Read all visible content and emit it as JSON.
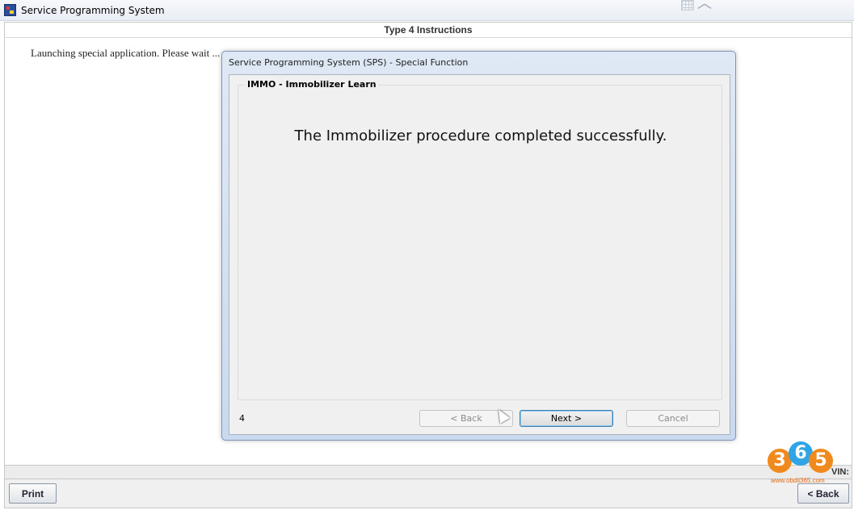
{
  "app": {
    "title": "Service Programming System"
  },
  "section": {
    "header": "Type 4 Instructions",
    "launch_text": "Launching special application. Please wait ..."
  },
  "dialog": {
    "title": "Service Programming System (SPS) - Special Function",
    "group_label": "IMMO - Immobilizer Learn",
    "message": "The Immobilizer procedure completed successfully.",
    "step_number": "4",
    "back_label": "< Back",
    "next_label": "Next >",
    "cancel_label": "Cancel"
  },
  "status_bar": {
    "vin_label": "VIN:"
  },
  "bottom_bar": {
    "print_label": "Print",
    "back_label": "< Back"
  },
  "watermark": {
    "digit1": "3",
    "digit2": "6",
    "digit3": "5",
    "url": "www.obdii365.com"
  },
  "icons": {
    "app": "sps-app-icon",
    "grid": "grid-icon",
    "chevron": "chevron-up-icon",
    "cursor": "mouse-cursor-icon"
  },
  "colors": {
    "dialog_frame": "#c9daee",
    "default_button_border": "#3c7fb1",
    "watermark_orange": "#f08a1d",
    "watermark_blue": "#2fa4e7"
  }
}
